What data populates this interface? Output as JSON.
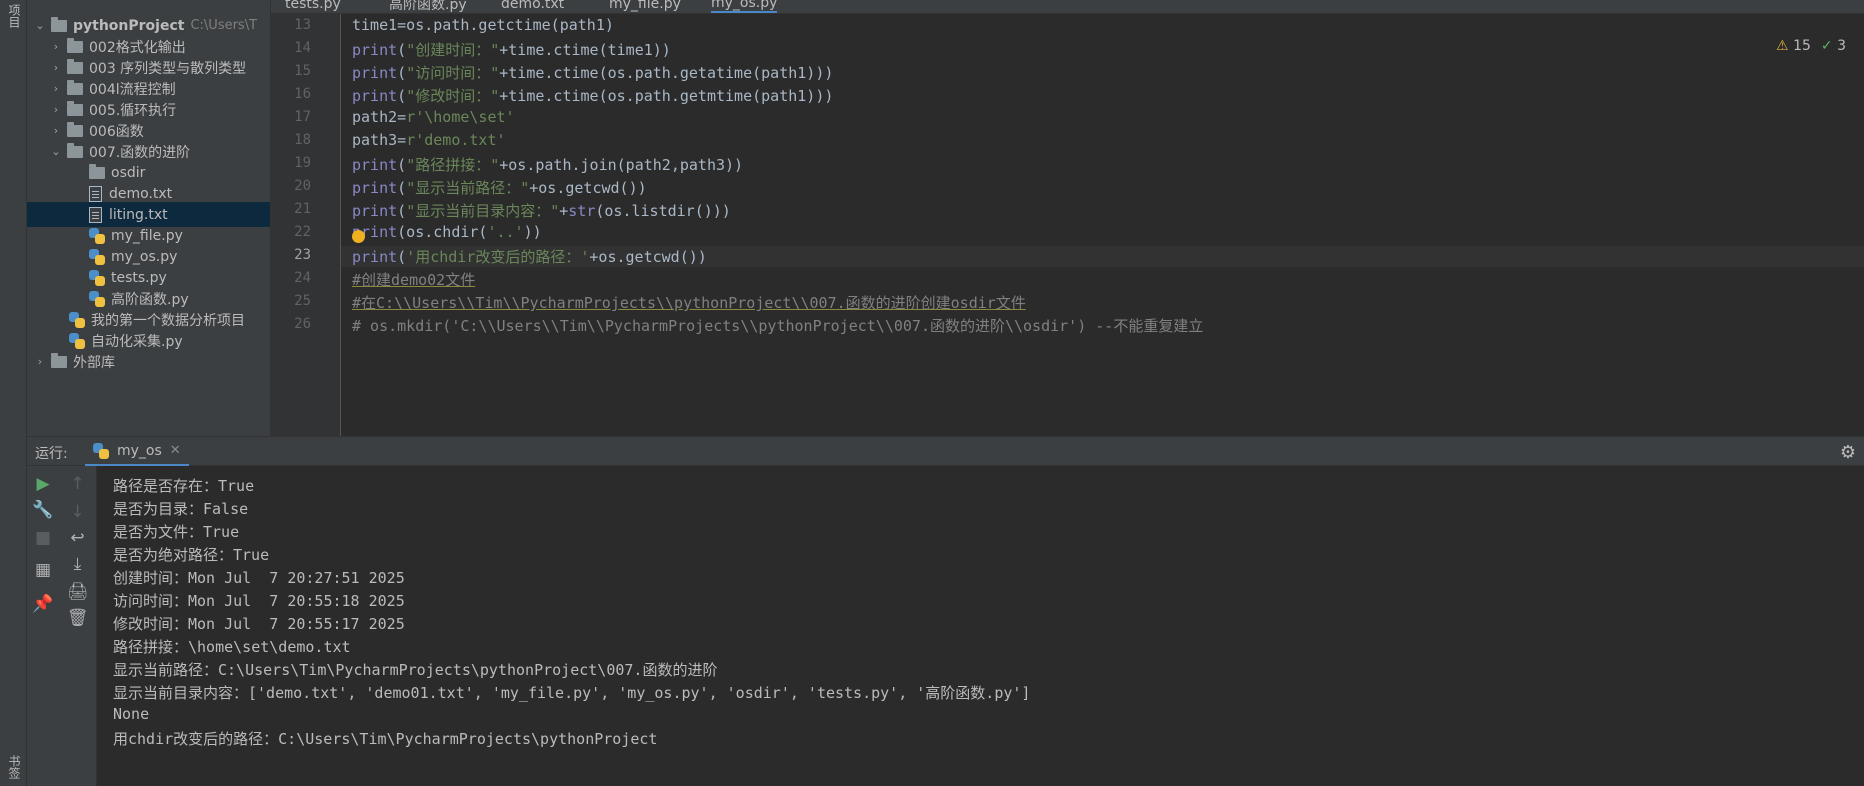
{
  "left_strip": {
    "top_label": "项目",
    "bottom_label": "书签"
  },
  "project": {
    "root_name": "pythonProject",
    "root_path": "C:\\Users\\T",
    "items": [
      {
        "label": "002格式化输出"
      },
      {
        "label": "003 序列类型与散列类型"
      },
      {
        "label": "004l流程控制"
      },
      {
        "label": "005.循环执行"
      },
      {
        "label": "006函数"
      },
      {
        "label": "007.函数的进阶"
      },
      {
        "label": "osdir"
      },
      {
        "label": "demo.txt"
      },
      {
        "label": "liting.txt"
      },
      {
        "label": "my_file.py"
      },
      {
        "label": "my_os.py"
      },
      {
        "label": "tests.py"
      },
      {
        "label": "高阶函数.py"
      },
      {
        "label": "我的第一个数据分析项目"
      },
      {
        "label": "自动化采集.py"
      },
      {
        "label": "外部库"
      }
    ]
  },
  "tabs": [
    "tests.py",
    "高阶函数.py",
    "demo.txt",
    "my_file.py",
    "my_os.py"
  ],
  "inspections": {
    "warnings": "15",
    "ok": "3"
  },
  "editor": {
    "line_numbers": [
      "13",
      "14",
      "15",
      "16",
      "17",
      "18",
      "19",
      "20",
      "21",
      "22",
      "23",
      "24",
      "25",
      "26"
    ]
  },
  "run": {
    "label": "运行:",
    "tab": "my_os",
    "output": [
      "路径是否存在：True",
      "是否为目录：False",
      "是否为文件：True",
      "是否为绝对路径：True",
      "创建时间：Mon Jul  7 20:27:51 2025",
      "访问时间：Mon Jul  7 20:55:18 2025",
      "修改时间：Mon Jul  7 20:55:17 2025",
      "路径拼接：\\home\\set\\demo.txt",
      "显示当前路径：C:\\Users\\Tim\\PycharmProjects\\pythonProject\\007.函数的进阶",
      "显示当前目录内容：['demo.txt', 'demo01.txt', 'my_file.py', 'my_os.py', 'osdir', 'tests.py', '高阶函数.py']",
      "None",
      "用chdir改变后的路径：C:\\Users\\Tim\\PycharmProjects\\pythonProject"
    ]
  },
  "colors": {
    "accent": "#4a88c7",
    "keyword": "#8888c6",
    "string": "#6a8759",
    "comment": "#808080"
  }
}
